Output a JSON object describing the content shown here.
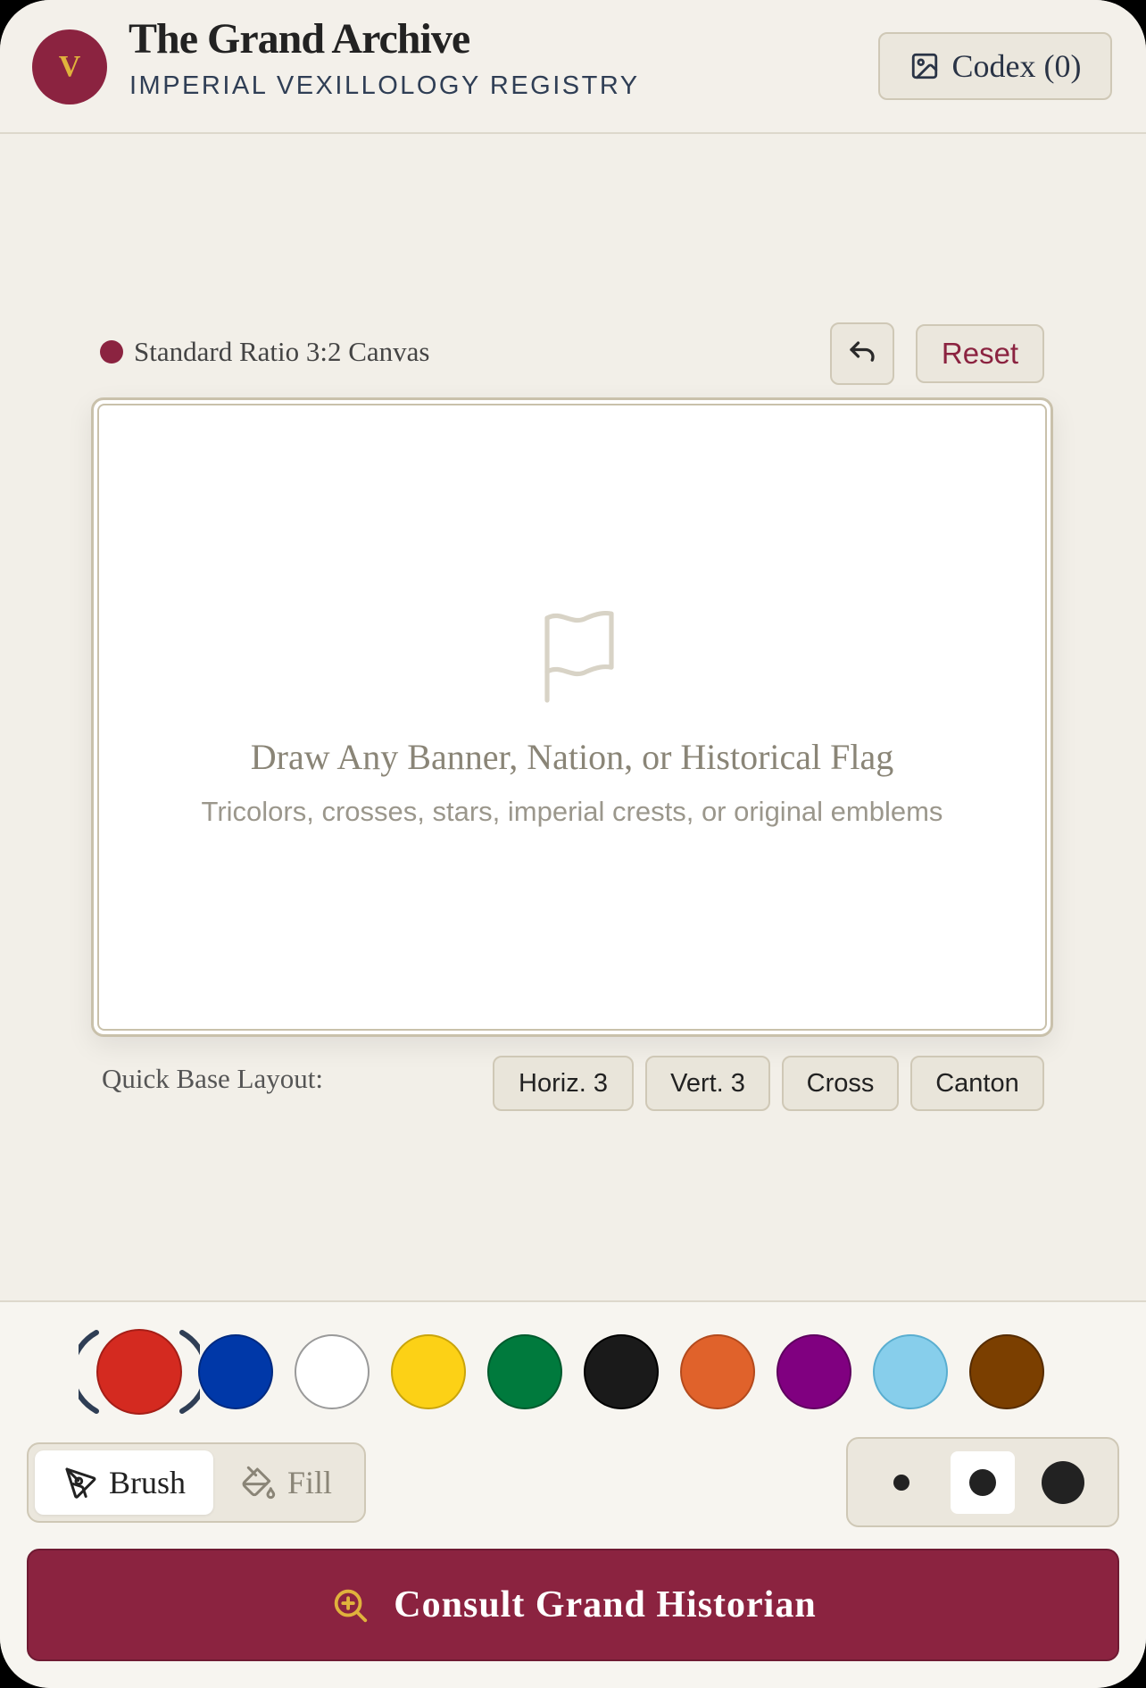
{
  "header": {
    "logo_letter": "V",
    "title": "The Grand Archive",
    "subtitle": "IMPERIAL VEXILLOLOGY REGISTRY",
    "codex_label": "Codex (0)"
  },
  "canvas": {
    "label": "Standard Ratio 3:2 Canvas",
    "reset_label": "Reset",
    "empty_title": "Draw Any Banner, Nation, or Historical Flag",
    "empty_hint": "Tricolors, crosses, stars, imperial crests, or original emblems"
  },
  "quick_layout": {
    "label": "Quick Base Layout:",
    "options": [
      "Horiz. 3",
      "Vert. 3",
      "Cross",
      "Canton"
    ]
  },
  "palette": {
    "selected": "#d42a20",
    "colors": [
      "#d42a20",
      "#0038a8",
      "#ffffff",
      "#fcd116",
      "#007a3d",
      "#1a1a1a",
      "#e0622b",
      "#800080",
      "#87ceeb",
      "#7b3f00"
    ]
  },
  "tools": {
    "brush_label": "Brush",
    "fill_label": "Fill",
    "active": "brush"
  },
  "brush_size": {
    "options": [
      "small",
      "medium",
      "large"
    ],
    "active": "medium"
  },
  "cta": {
    "label": "Consult Grand Historian"
  },
  "colors": {
    "accent": "#8b2340",
    "gold": "#e0b23c",
    "background": "#f2efe8"
  },
  "icons": {
    "codex": "image-icon",
    "undo": "undo-icon",
    "canvas_placeholder": "flag-icon",
    "brush": "pen-tool-icon",
    "fill": "paint-bucket-icon",
    "cta": "search-plus-icon"
  }
}
